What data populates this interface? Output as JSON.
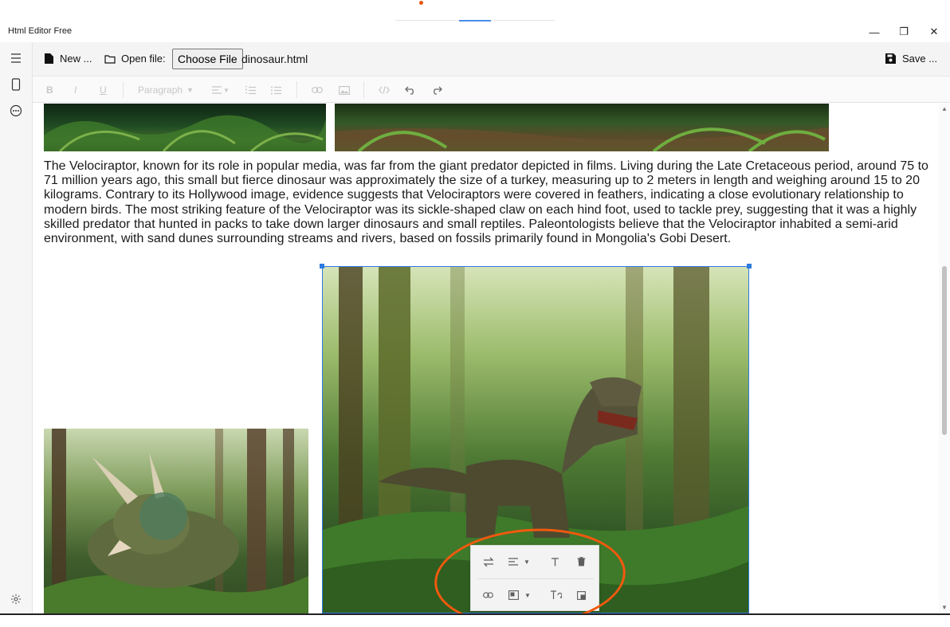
{
  "window": {
    "title": "Html Editor Free",
    "min_glyph": "—",
    "max_glyph": "❐",
    "close_glyph": "✕"
  },
  "filebar": {
    "new_label": "New ...",
    "open_label": "Open file:",
    "choose_label": "Choose File",
    "file_name": "dinosaur.html",
    "save_label": "Save ..."
  },
  "toolbar": {
    "bold": "B",
    "italic": "I",
    "underline": "U",
    "paragraph": "Paragraph"
  },
  "document": {
    "paragraph": "The Velociraptor, known for its role in popular media, was far from the giant predator depicted in films. Living during the Late Cretaceous period, around 75 to 71 million years ago, this small but fierce dinosaur was approximately the size of a turkey, measuring up to 2 meters in length and weighing around 15 to 20 kilograms. Contrary to its Hollywood image, evidence suggests that Velociraptors were covered in feathers, indicating a close evolutionary relationship to modern birds. The most striking feature of the Velociraptor was its sickle-shaped claw on each hind foot, used to tackle prey, suggesting that it was a highly skilled predator that hunted in packs to take down larger dinosaurs and small reptiles. Paleontologists believe that the Velociraptor inhabited a semi-arid environment, with sand dunes surrounding streams and rivers, based on fossils primarily found in Mongolia's Gobi Desert."
  },
  "colors": {
    "accent": "#2d7ae0",
    "highlight": "#f2590f"
  }
}
